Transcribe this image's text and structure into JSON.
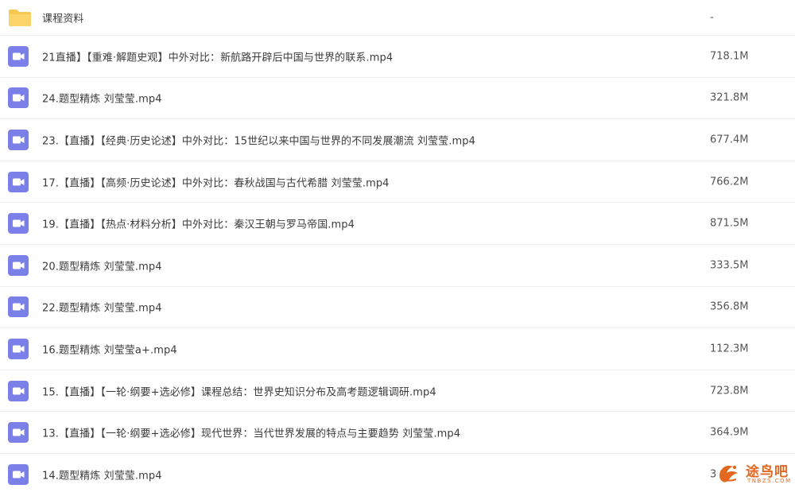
{
  "colors": {
    "video_icon": "#7b7fe8",
    "folder_icon": "#f9c74f",
    "row_divider": "#eeeeee",
    "watermark": "#e2671f"
  },
  "files": [
    {
      "icon": "folder-icon",
      "name": "课程资料",
      "size": "-"
    },
    {
      "icon": "video-icon",
      "name": "21直播】【重难·解题史观】中外对比：新航路开辟后中国与世界的联系.mp4",
      "size": "718.1M"
    },
    {
      "icon": "video-icon",
      "name": "24.题型精炼 刘莹莹.mp4",
      "size": "321.8M"
    },
    {
      "icon": "video-icon",
      "name": "23.【直播】【经典·历史论述】中外对比：15世纪以来中国与世界的不同发展潮流 刘莹莹.mp4",
      "size": "677.4M"
    },
    {
      "icon": "video-icon",
      "name": "17.【直播】【高频·历史论述】中外对比：春秋战国与古代希腊 刘莹莹.mp4",
      "size": "766.2M"
    },
    {
      "icon": "video-icon",
      "name": "19.【直播】【热点·材料分析】中外对比：秦汉王朝与罗马帝国.mp4",
      "size": "871.5M"
    },
    {
      "icon": "video-icon",
      "name": "20.题型精炼 刘莹莹.mp4",
      "size": "333.5M"
    },
    {
      "icon": "video-icon",
      "name": "22.题型精炼 刘莹莹.mp4",
      "size": "356.8M"
    },
    {
      "icon": "video-icon",
      "name": "16.题型精炼 刘莹莹a+.mp4",
      "size": "112.3M"
    },
    {
      "icon": "video-icon",
      "name": "15.【直播】【一轮·纲要+选必修】课程总结：世界史知识分布及高考题逻辑调研.mp4",
      "size": "723.8M"
    },
    {
      "icon": "video-icon",
      "name": "13.【直播】【一轮·纲要+选必修】现代世界：当代世界发展的特点与主要趋势 刘莹莹.mp4",
      "size": "364.9M"
    },
    {
      "icon": "video-icon",
      "name": "14.题型精炼 刘莹莹.mp4",
      "size": "3"
    }
  ],
  "watermark": {
    "icon": "tuniao-logo-icon",
    "text": "途鸟吧",
    "subtext": "TNBZS.COM"
  }
}
